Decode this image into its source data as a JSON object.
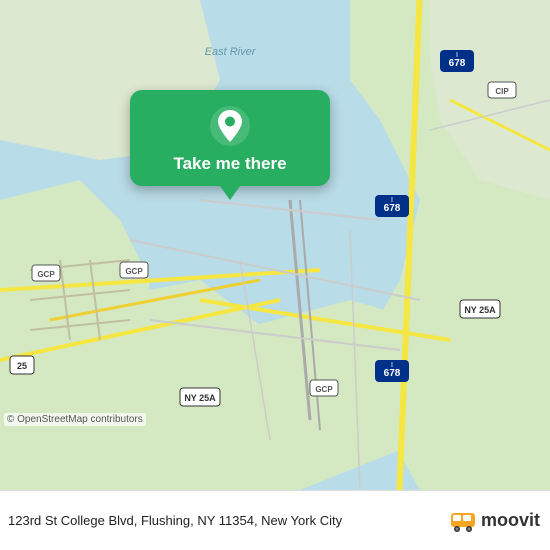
{
  "map": {
    "background_water": "#b8dce8",
    "background_land": "#e8ead0",
    "label_east_river": "East River",
    "label_i678_1": "I 678",
    "label_i678_2": "I 678",
    "label_ny25a_1": "NY 25A",
    "label_ny25a_2": "NY 25A",
    "label_gcp_1": "GCP",
    "label_gcp_2": "GCP",
    "label_gcp_3": "GCP",
    "label_cip": "CIP",
    "label_25": "25"
  },
  "popup": {
    "label": "Take me there",
    "bg_color": "#27ae60"
  },
  "footer": {
    "address": "123rd St College Blvd, Flushing, NY 11354, New York",
    "city": "City",
    "copyright": "© OpenStreetMap contributors"
  },
  "moovit": {
    "logo_text": "moovit"
  }
}
